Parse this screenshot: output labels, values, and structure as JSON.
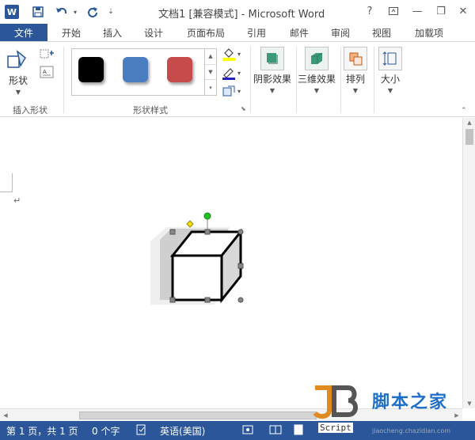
{
  "titlebar": {
    "title": "文档1 [兼容模式] - Microsoft Word",
    "app_icon": "word-icon",
    "qat_icons": [
      "save-icon",
      "undo-icon",
      "redo-icon",
      "customize-qat-icon"
    ],
    "window_buttons": [
      "help-icon",
      "ribbon-display-icon",
      "minimize-icon",
      "restore-icon",
      "close-icon"
    ],
    "help_label": "?",
    "minimize_label": "—",
    "restore_label": "❐",
    "close_label": "✕"
  },
  "tabs": {
    "file": "文件",
    "items": [
      "开始",
      "插入",
      "设计",
      "页面布局",
      "引用",
      "邮件",
      "审阅",
      "视图",
      "加载项"
    ]
  },
  "ribbon": {
    "insert_shapes": {
      "shapes_label": "形状",
      "group_label": "插入形状"
    },
    "shape_styles": {
      "group_label": "形状样式",
      "swatches": [
        "#000000",
        "#4a7ec0",
        "#c84b4b"
      ],
      "fill_color": "#ffff00",
      "outline_color": "#2020c0"
    },
    "shadow_effects": "阴影效果",
    "3d_effects": "三维效果",
    "arrange": "排列",
    "size": "大小"
  },
  "document": {
    "paragraph_mark": "↵"
  },
  "statusbar": {
    "page": "第 1 页，共 1 页",
    "words": "0 个字",
    "language": "英语(美国)"
  },
  "watermark": {
    "text": "脚本之家",
    "script": "Script",
    "url": "jiaocheng.chazidian.com"
  },
  "colors": {
    "accent": "#2b579a",
    "handle_green": "#22c022",
    "handle_yellow": "#f0e000"
  }
}
